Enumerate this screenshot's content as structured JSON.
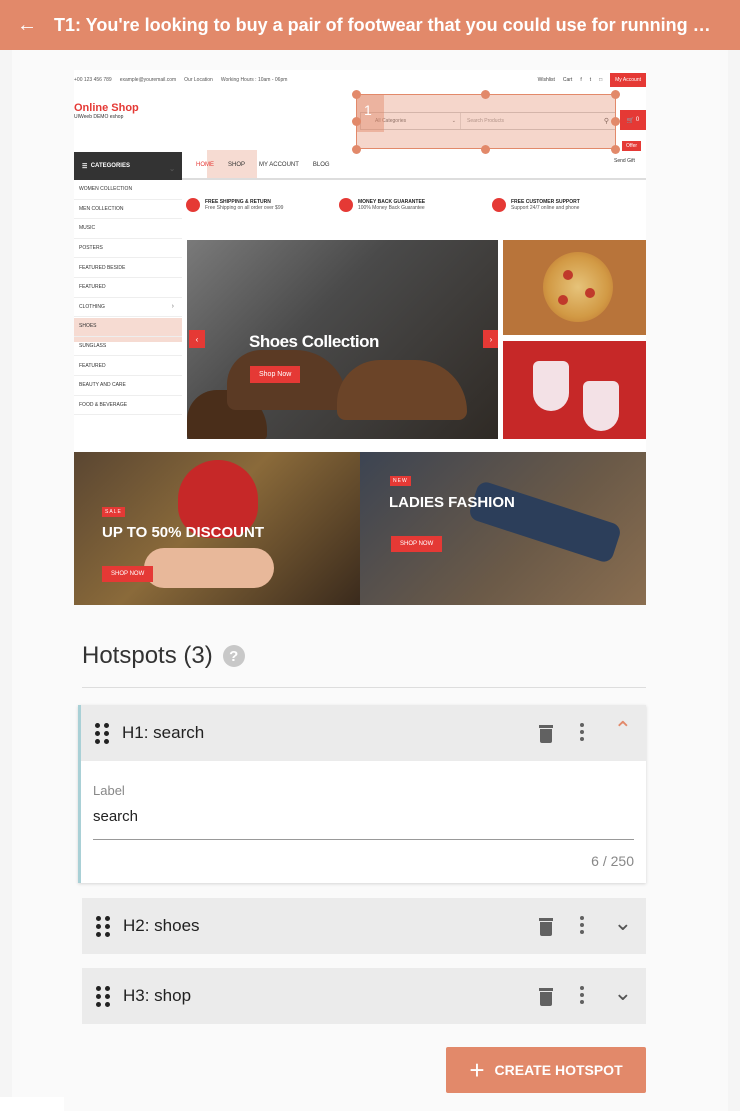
{
  "header": {
    "title": "T1: You're looking to buy a pair of footwear that you could use for running and othe...",
    "back_icon": "arrow-left-icon"
  },
  "shop": {
    "phone": "+00 123 456 789",
    "email": "example@youremail.com",
    "location": "Our Location",
    "hours": "Working Hours : 10am - 06pm",
    "wishlist": "Wishlist",
    "cart": "Cart",
    "my_account": "My Account",
    "logo_title": "Online Shop",
    "logo_sub": "UIWeeb DEMO eshop",
    "search_category": "All Categories",
    "search_placeholder": "Search Products",
    "cart_count": "0",
    "offer": "Offer",
    "send_gift": "Send Gift",
    "hotspot_number": "1",
    "categories_label": "CATEGORIES",
    "menu": [
      "HOME",
      "SHOP",
      "MY ACCOUNT",
      "BLOG"
    ],
    "category_list": [
      "WOMEN COLLECTION",
      "MEN COLLECTION",
      "MUSIC",
      "POSTERS",
      "FEATURED BESIDE",
      "FEATURED",
      "CLOTHING",
      "SHOES",
      "SUNGLASS",
      "FEATURED",
      "BEAUTY AND CARE",
      "FOOD & BEVERAGE"
    ],
    "features": [
      {
        "title": "FREE SHIPPING & RETURN",
        "sub": "Free Shipping on all order over $99"
      },
      {
        "title": "MONEY BACK GUARANTEE",
        "sub": "100% Money Back Guarantee"
      },
      {
        "title": "FREE CUSTOMER SUPPORT",
        "sub": "Support 24/7 online and phone"
      }
    ],
    "slider_title": "Shoes Collection",
    "slider_button": "Shop Now",
    "banner1_tag": "SALE",
    "banner1_title": "UP TO 50% DISCOUNT",
    "banner1_button": "SHOP NOW",
    "banner2_tag": "NEW",
    "banner2_title": "LADIES FASHION",
    "banner2_button": "SHOP NOW"
  },
  "hotspots": {
    "title": "Hotspots (3)",
    "help_icon": "?",
    "items": [
      {
        "name": "H1: search",
        "label_caption": "Label",
        "label_value": "search",
        "counter": "6 / 250"
      },
      {
        "name": "H2: shoes"
      },
      {
        "name": "H3: shop"
      }
    ],
    "create_button": "CREATE HOTSPOT",
    "create_icon": "+"
  },
  "colors": {
    "accent": "#e2896a",
    "shop_red": "#e53935"
  }
}
